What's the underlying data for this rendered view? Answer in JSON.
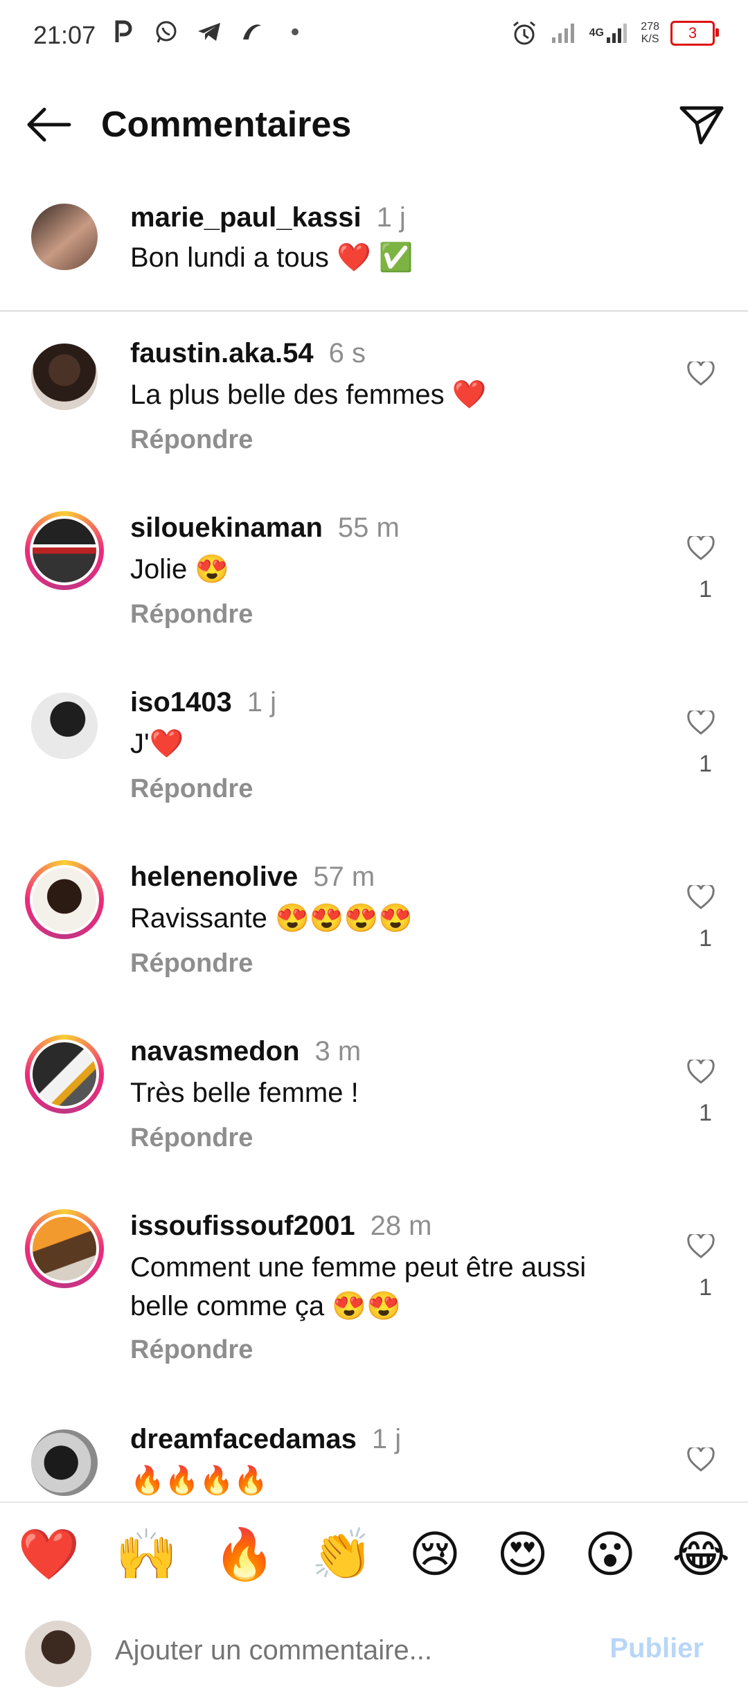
{
  "status_bar": {
    "time": "21:07",
    "net_speed_value": "278",
    "net_speed_unit": "K/S",
    "network_label": "4G",
    "battery_level": "3",
    "left_icons": [
      "p-icon",
      "whatsapp-icon",
      "telegram-icon",
      "app-icon",
      "dot-icon"
    ],
    "right_icons": [
      "alarm-icon",
      "signal-icon",
      "signal-4g-icon",
      "battery-icon"
    ]
  },
  "header": {
    "title": "Commentaires",
    "back_icon": "arrow-left-icon",
    "share_icon": "send-icon"
  },
  "caption": {
    "username": "marie_paul_kassi",
    "time": "1 j",
    "text": "Bon lundi a tous ❤️ ✅"
  },
  "comments": [
    {
      "username": "faustin.aka.54",
      "time": "6 s",
      "text": "La plus belle des femmes ❤️",
      "reply_label": "Répondre",
      "likes": ""
    },
    {
      "username": "silouekinaman",
      "time": "55 m",
      "text": "Jolie 😍",
      "reply_label": "Répondre",
      "likes": "1"
    },
    {
      "username": "iso1403",
      "time": "1 j",
      "text": "J'❤️",
      "reply_label": "Répondre",
      "likes": "1"
    },
    {
      "username": "helenenolive",
      "time": "57 m",
      "text": "Ravissante 😍😍😍😍",
      "reply_label": "Répondre",
      "likes": "1"
    },
    {
      "username": "navasmedon",
      "time": "3 m",
      "text": "Très belle femme !",
      "reply_label": "Répondre",
      "likes": "1"
    },
    {
      "username": "issoufissouf2001",
      "time": "28 m",
      "text": "Comment une femme peut être aussi belle comme ça 😍😍",
      "reply_label": "Répondre",
      "likes": "1"
    },
    {
      "username": "dreamfacedamas",
      "time": "1 j",
      "text": "🔥🔥🔥🔥",
      "reply_label": "",
      "likes": ""
    }
  ],
  "emoji_bar": [
    "❤️",
    "🙌",
    "🔥",
    "👏",
    "😢",
    "😍",
    "😮",
    "😂"
  ],
  "composer": {
    "placeholder": "Ajouter un commentaire...",
    "publish_label": "Publier"
  },
  "colors": {
    "ring_gradient_start": "#f9ce34",
    "ring_gradient_mid": "#ee2a7b",
    "publish_disabled": "#b8d6f7",
    "secondary_text": "#8e8e8e",
    "battery": "#dd1111"
  }
}
